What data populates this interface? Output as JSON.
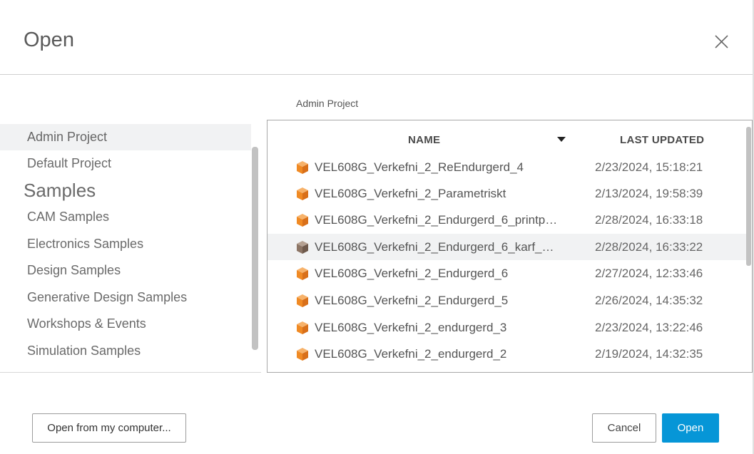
{
  "dialog": {
    "title": "Open",
    "close_icon": "close-icon"
  },
  "sidebar": {
    "projects": [
      {
        "label": "Admin Project",
        "active": true
      },
      {
        "label": "Default Project",
        "active": false
      }
    ],
    "samples_heading": "Samples",
    "samples": [
      {
        "label": "CAM Samples"
      },
      {
        "label": "Electronics Samples"
      },
      {
        "label": "Design Samples"
      },
      {
        "label": "Generative Design Samples"
      },
      {
        "label": "Workshops & Events"
      },
      {
        "label": "Simulation Samples"
      }
    ]
  },
  "breadcrumb": "Admin Project",
  "file_list": {
    "columns": {
      "name": "NAME",
      "last_updated": "LAST UPDATED"
    },
    "sort_icon": "sort-descending-icon",
    "rows": [
      {
        "name": "VEL608G_Verkefni_2_ReEndurgerd_4",
        "date": "2/23/2024, 15:18:21",
        "icon": "orange-cube-icon",
        "highlighted": false
      },
      {
        "name": "VEL608G_Verkefni_2_Parametriskt",
        "date": "2/13/2024, 19:58:39",
        "icon": "orange-cube-icon",
        "highlighted": false
      },
      {
        "name": "VEL608G_Verkefni_2_Endurgerd_6_printp…",
        "date": "2/28/2024, 16:33:18",
        "icon": "orange-cube-icon",
        "highlighted": false
      },
      {
        "name": "VEL608G_Verkefni_2_Endurgerd_6_karf_…",
        "date": "2/28/2024, 16:33:22",
        "icon": "brown-cube-icon",
        "highlighted": true
      },
      {
        "name": "VEL608G_Verkefni_2_Endurgerd_6",
        "date": "2/27/2024, 12:33:46",
        "icon": "orange-cube-icon",
        "highlighted": false
      },
      {
        "name": "VEL608G_Verkefni_2_Endurgerd_5",
        "date": "2/26/2024, 14:35:32",
        "icon": "orange-cube-icon",
        "highlighted": false
      },
      {
        "name": "VEL608G_Verkefni_2_endurgerd_3",
        "date": "2/23/2024, 13:22:46",
        "icon": "orange-cube-icon",
        "highlighted": false
      },
      {
        "name": "VEL608G_Verkefni_2_endurgerd_2",
        "date": "2/19/2024, 14:32:35",
        "icon": "orange-cube-icon",
        "highlighted": false
      }
    ]
  },
  "buttons": {
    "open_from_computer": "Open from my computer...",
    "cancel": "Cancel",
    "open": "Open"
  },
  "colors": {
    "accent": "#0696d7",
    "cube_orange": "#f08a24",
    "cube_brown": "#8c7565",
    "highlight_row": "#f1f2f3"
  }
}
